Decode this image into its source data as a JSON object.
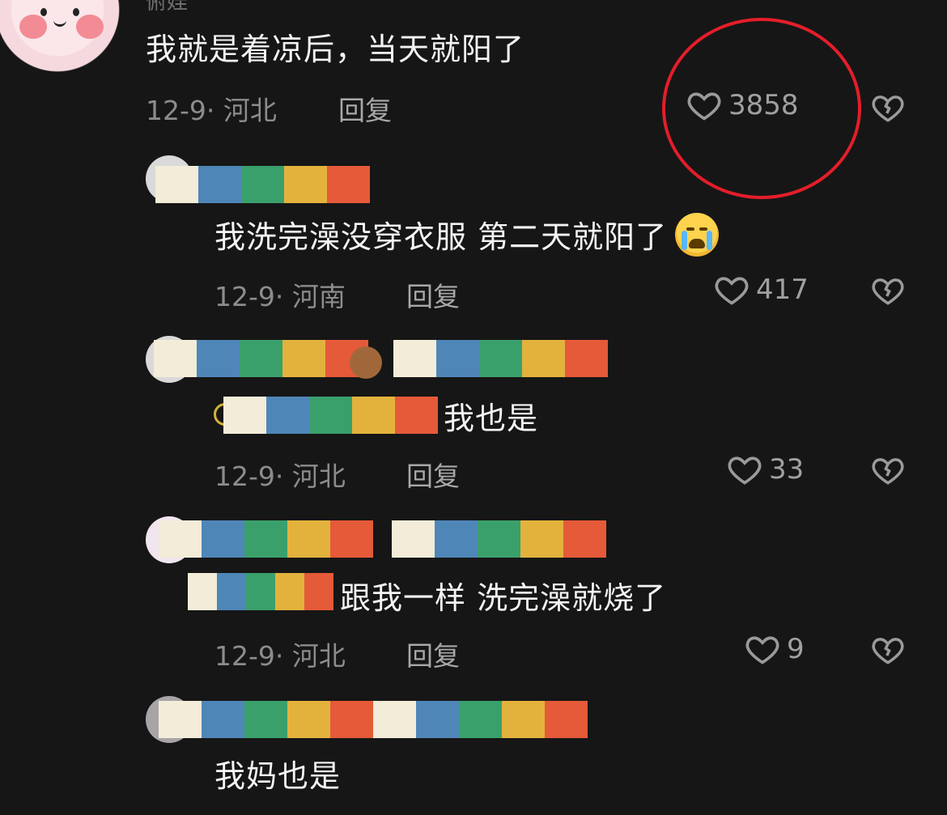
{
  "colors": {
    "background": "#161616",
    "text": "#f2f2f2",
    "meta": "#8c8c8c",
    "highlight_circle": "#e31e2a",
    "censor_palette": [
      "#f2ecd8",
      "#4f86b8",
      "#3aa06b",
      "#e3b23c",
      "#e55a39"
    ]
  },
  "icons": {
    "like": "heart-outline-icon",
    "dislike": "broken-heart-icon",
    "emoji": "crying-face-emoji"
  },
  "comments": [
    {
      "username_partial": "俯娃",
      "text": "我就是着凉后，当天就阳了",
      "date_location": "12-9· 河北",
      "reply_label": "回复",
      "likes": "3858"
    },
    {
      "text": "我洗完澡没穿衣服 第二天就阳了",
      "date_location": "12-9· 河南",
      "reply_label": "回复",
      "likes": "417"
    },
    {
      "text": "我也是",
      "date_location": "12-9· 河北",
      "reply_label": "回复",
      "likes": "33"
    },
    {
      "text": "跟我一样 洗完澡就烧了",
      "date_location": "12-9· 河北",
      "reply_label": "回复",
      "likes": "9"
    },
    {
      "text": "我妈也是"
    }
  ]
}
